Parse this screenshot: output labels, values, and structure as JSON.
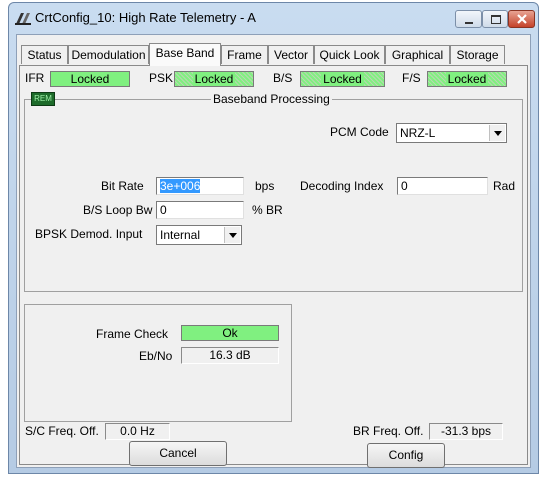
{
  "window": {
    "title": "CrtConfig_10: High Rate Telemetry - A",
    "controls": {
      "minimize": "minimize-icon",
      "maximize": "maximize-icon",
      "close": "close-icon"
    }
  },
  "tabs": [
    {
      "label": "Status"
    },
    {
      "label": "Demodulation"
    },
    {
      "label": "Base Band"
    },
    {
      "label": "Frame"
    },
    {
      "label": "Vector"
    },
    {
      "label": "Quick Look"
    },
    {
      "label": "Graphical"
    },
    {
      "label": "Storage"
    }
  ],
  "active_tab": "Base Band",
  "status_bar": {
    "ifr": {
      "label": "IFR",
      "value": "Locked"
    },
    "psk": {
      "label": "PSK",
      "value": "Locked"
    },
    "bs": {
      "label": "B/S",
      "value": "Locked"
    },
    "fs": {
      "label": "F/S",
      "value": "Locked"
    },
    "lamp_color": "#80f080"
  },
  "baseband": {
    "group_title": "Baseband Processing",
    "led_text": "REM",
    "pcm_code": {
      "label": "PCM Code",
      "value": "NRZ-L"
    },
    "bit_rate": {
      "label": "Bit Rate",
      "value": "3e+006",
      "unit": "bps"
    },
    "decoding_index": {
      "label": "Decoding Index",
      "value": "0",
      "unit": "Rad"
    },
    "bs_loop_bw": {
      "label": "B/S Loop Bw",
      "value": "0",
      "unit": "% BR"
    },
    "bpsk_input": {
      "label": "BPSK Demod. Input",
      "value": "Internal"
    }
  },
  "frame_check": {
    "label": "Frame Check",
    "value": "Ok"
  },
  "ebno": {
    "label": "Eb/No",
    "value": "16.3 dB"
  },
  "sc_freq_off": {
    "label": "S/C Freq. Off.",
    "value": "0.0 Hz"
  },
  "br_freq_off": {
    "label": "BR Freq. Off.",
    "value": "-31.3 bps"
  },
  "buttons": {
    "cancel": "Cancel",
    "config": "Config"
  }
}
